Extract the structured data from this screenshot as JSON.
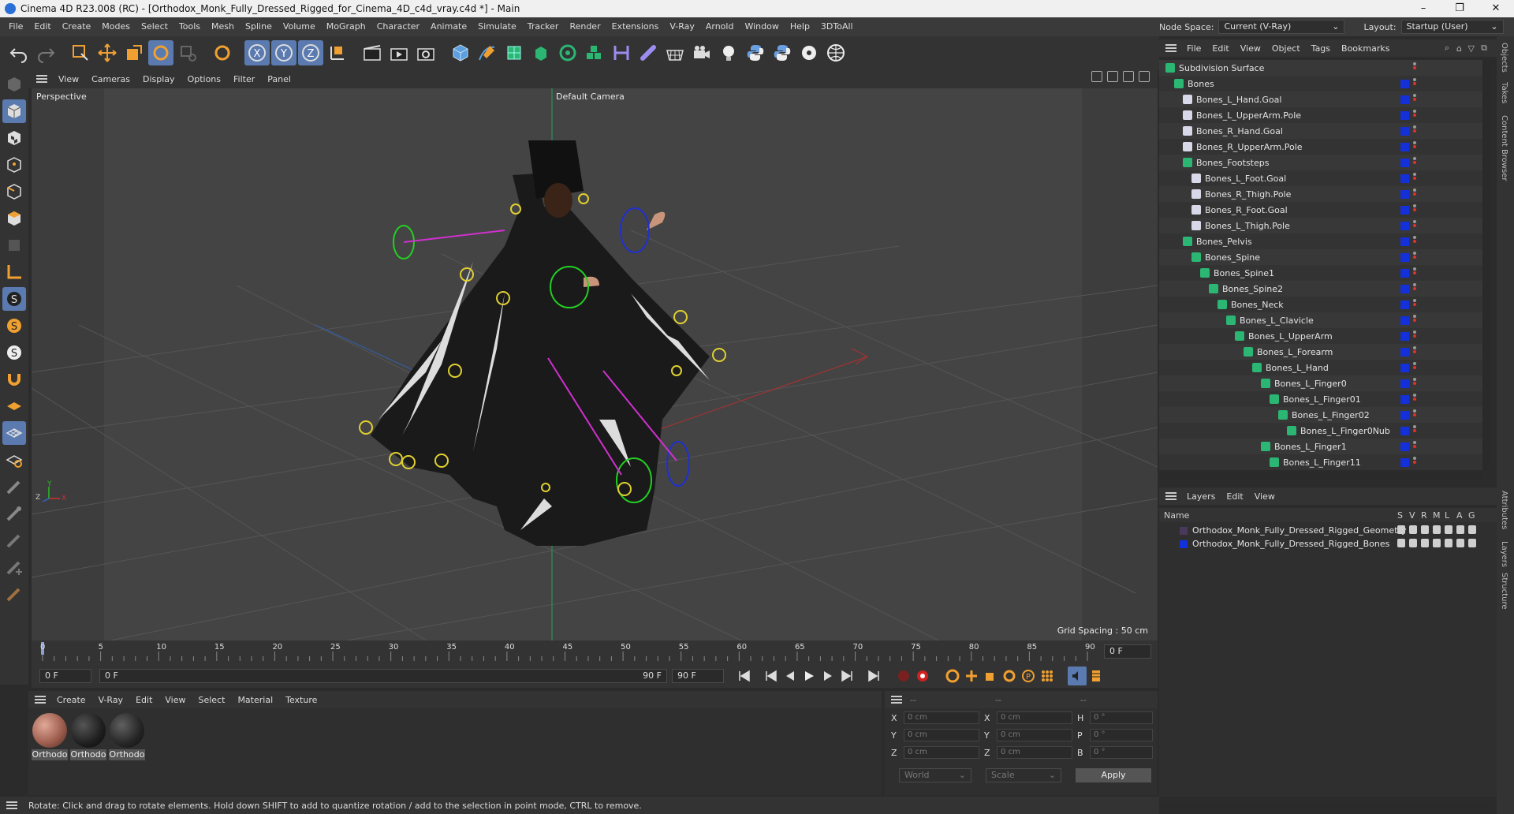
{
  "window": {
    "title": "Cinema 4D R23.008 (RC) - [Orthodox_Monk_Fully_Dressed_Rigged_for_Cinema_4D_c4d_vray.c4d *] - Main",
    "minimize": "–",
    "maximize": "❐",
    "close": "✕"
  },
  "menubar": [
    "File",
    "Edit",
    "Create",
    "Modes",
    "Select",
    "Tools",
    "Mesh",
    "Spline",
    "Volume",
    "MoGraph",
    "Character",
    "Animate",
    "Simulate",
    "Tracker",
    "Render",
    "Extensions",
    "V-Ray",
    "Arnold",
    "Window",
    "Help",
    "3DToAll"
  ],
  "nodespace": {
    "label": "Node Space:",
    "value": "Current (V-Ray)",
    "layout_label": "Layout:",
    "layout_value": "Startup (User)"
  },
  "viewport": {
    "menu": [
      "View",
      "Cameras",
      "Display",
      "Options",
      "Filter",
      "Panel"
    ],
    "label": "Perspective",
    "camera": "Default Camera",
    "grid_spacing": "Grid Spacing : 50 cm",
    "axes": {
      "x": "X",
      "y": "Y",
      "z": "Z"
    }
  },
  "timeline": {
    "ticks": [
      "0",
      "5",
      "10",
      "15",
      "20",
      "25",
      "30",
      "35",
      "40",
      "45",
      "50",
      "55",
      "60",
      "65",
      "70",
      "75",
      "80",
      "85",
      "90"
    ],
    "current_frame": "0 F",
    "start_frame": "0 F",
    "range_start": "0 F",
    "range_end": "90 F",
    "end_frame": "90 F"
  },
  "material_manager": {
    "menu": [
      "Create",
      "V-Ray",
      "Edit",
      "View",
      "Select",
      "Material",
      "Texture"
    ],
    "materials": [
      {
        "name": "Orthodo",
        "color": "#b07060"
      },
      {
        "name": "Orthodo",
        "color": "#2a2a2a"
      },
      {
        "name": "Orthodo",
        "color": "#303030"
      }
    ]
  },
  "coordinates": {
    "header": [
      "--",
      "--",
      "--"
    ],
    "rows": [
      {
        "a": "X",
        "av": "0 cm",
        "b": "X",
        "bv": "0 cm",
        "c": "H",
        "cv": "0 °"
      },
      {
        "a": "Y",
        "av": "0 cm",
        "b": "Y",
        "bv": "0 cm",
        "c": "P",
        "cv": "0 °"
      },
      {
        "a": "Z",
        "av": "0 cm",
        "b": "Z",
        "bv": "0 cm",
        "c": "B",
        "cv": "0 °"
      }
    ],
    "space": "World",
    "mode": "Scale",
    "apply": "Apply"
  },
  "status": "Rotate: Click and drag to rotate elements. Hold down SHIFT to add to quantize rotation / add to the selection in point mode, CTRL to remove.",
  "object_manager": {
    "menu": [
      "File",
      "Edit",
      "View",
      "Object",
      "Tags",
      "Bookmarks"
    ],
    "items": [
      {
        "name": "Subdivision Surface",
        "depth": 0
      },
      {
        "name": "Bones",
        "depth": 1
      },
      {
        "name": "Bones_L_Hand.Goal",
        "depth": 2
      },
      {
        "name": "Bones_L_UpperArm.Pole",
        "depth": 2
      },
      {
        "name": "Bones_R_Hand.Goal",
        "depth": 2
      },
      {
        "name": "Bones_R_UpperArm.Pole",
        "depth": 2
      },
      {
        "name": "Bones_Footsteps",
        "depth": 2
      },
      {
        "name": "Bones_L_Foot.Goal",
        "depth": 3
      },
      {
        "name": "Bones_R_Thigh.Pole",
        "depth": 3
      },
      {
        "name": "Bones_R_Foot.Goal",
        "depth": 3
      },
      {
        "name": "Bones_L_Thigh.Pole",
        "depth": 3
      },
      {
        "name": "Bones_Pelvis",
        "depth": 2
      },
      {
        "name": "Bones_Spine",
        "depth": 3
      },
      {
        "name": "Bones_Spine1",
        "depth": 4
      },
      {
        "name": "Bones_Spine2",
        "depth": 5
      },
      {
        "name": "Bones_Neck",
        "depth": 6
      },
      {
        "name": "Bones_L_Clavicle",
        "depth": 7
      },
      {
        "name": "Bones_L_UpperArm",
        "depth": 8
      },
      {
        "name": "Bones_L_Forearm",
        "depth": 9
      },
      {
        "name": "Bones_L_Hand",
        "depth": 10
      },
      {
        "name": "Bones_L_Finger0",
        "depth": 11
      },
      {
        "name": "Bones_L_Finger01",
        "depth": 12
      },
      {
        "name": "Bones_L_Finger02",
        "depth": 13
      },
      {
        "name": "Bones_L_Finger0Nub",
        "depth": 14
      },
      {
        "name": "Bones_L_Finger1",
        "depth": 11
      },
      {
        "name": "Bones_L_Finger11",
        "depth": 12
      }
    ]
  },
  "layers": {
    "menu": [
      "Layers",
      "Edit",
      "View"
    ],
    "columns": [
      "Name",
      "S",
      "V",
      "R",
      "M",
      "L",
      "A",
      "G"
    ],
    "items": [
      {
        "name": "Orthodox_Monk_Fully_Dressed_Rigged_Geometry",
        "color": "#4a3a5a"
      },
      {
        "name": "Orthodox_Monk_Fully_Dressed_Rigged_Bones",
        "color": "#1430d8"
      }
    ]
  },
  "side_tabs": [
    "Objects",
    "Takes",
    "Content Browser",
    "Attributes",
    "Layers",
    "Structure"
  ]
}
